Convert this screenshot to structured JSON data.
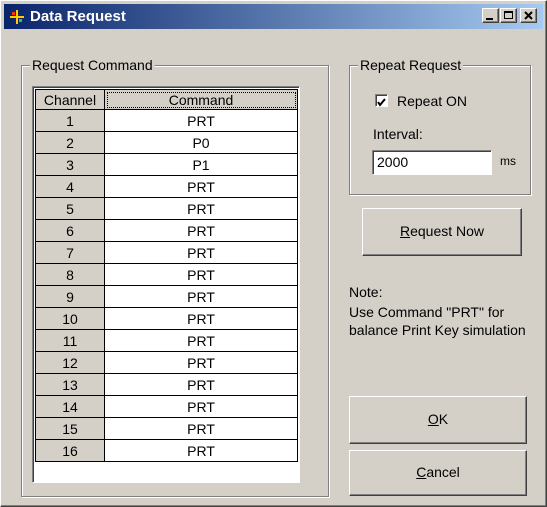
{
  "window": {
    "title": "Data Request",
    "icon": "app-icon",
    "controls": [
      "minimize-icon",
      "maximize-icon",
      "close-icon"
    ]
  },
  "request_group": {
    "label": "Request Command",
    "columns": [
      "Channel",
      "Command"
    ],
    "rows": [
      {
        "channel": "1",
        "command": "PRT"
      },
      {
        "channel": "2",
        "command": "P0"
      },
      {
        "channel": "3",
        "command": "P1"
      },
      {
        "channel": "4",
        "command": "PRT"
      },
      {
        "channel": "5",
        "command": "PRT"
      },
      {
        "channel": "6",
        "command": "PRT"
      },
      {
        "channel": "7",
        "command": "PRT"
      },
      {
        "channel": "8",
        "command": "PRT"
      },
      {
        "channel": "9",
        "command": "PRT"
      },
      {
        "channel": "10",
        "command": "PRT"
      },
      {
        "channel": "11",
        "command": "PRT"
      },
      {
        "channel": "12",
        "command": "PRT"
      },
      {
        "channel": "13",
        "command": "PRT"
      },
      {
        "channel": "14",
        "command": "PRT"
      },
      {
        "channel": "15",
        "command": "PRT"
      },
      {
        "channel": "16",
        "command": "PRT"
      }
    ]
  },
  "repeat_group": {
    "label": "Repeat Request",
    "checkbox_label_prefix": "",
    "checkbox_label": "Repeat ON",
    "checked": true,
    "interval_label": "Interval:",
    "interval_value": "2000",
    "unit": "ms"
  },
  "buttons": {
    "request_now_u": "R",
    "request_now_rest": "equest Now",
    "ok_u": "O",
    "ok_rest": "K",
    "cancel_u": "C",
    "cancel_rest": "ancel"
  },
  "note": {
    "title": "Note:",
    "line1": "Use Command \"PRT\" for",
    "line2": "balance Print Key simulation"
  }
}
